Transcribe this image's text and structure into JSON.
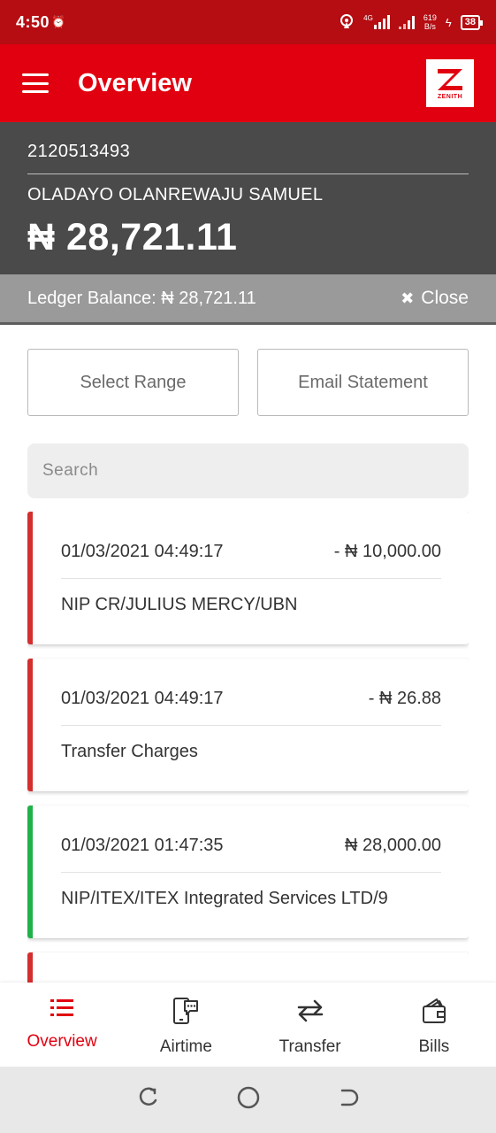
{
  "status_bar": {
    "time": "4:50",
    "network": "4G",
    "speed_value": "619",
    "speed_unit": "B/s",
    "battery": "38"
  },
  "app_bar": {
    "title": "Overview",
    "logo_text": "ZENITH",
    "logo_icon": "zenith-logo"
  },
  "account": {
    "number": "2120513493",
    "name": "OLADAYO OLANREWAJU SAMUEL",
    "balance": "₦ 28,721.11"
  },
  "ledger": {
    "label": "Ledger Balance: ₦ 28,721.11",
    "close_label": "Close"
  },
  "actions": {
    "select_range": "Select Range",
    "email_statement": "Email Statement"
  },
  "search": {
    "placeholder": "Search"
  },
  "transactions": [
    {
      "datetime": "01/03/2021 04:49:17",
      "amount": "- ₦ 10,000.00",
      "description": "NIP CR/JULIUS MERCY/UBN",
      "type": "debit"
    },
    {
      "datetime": "01/03/2021 04:49:17",
      "amount": "- ₦ 26.88",
      "description": "Transfer Charges",
      "type": "debit"
    },
    {
      "datetime": "01/03/2021 01:47:35",
      "amount": "₦ 28,000.00",
      "description": "NIP/ITEX/ITEX Integrated Services LTD/9",
      "type": "credit"
    }
  ],
  "bottom_nav": [
    {
      "label": "Overview",
      "icon": "list-icon",
      "active": true
    },
    {
      "label": "Airtime",
      "icon": "phone-chat-icon",
      "active": false
    },
    {
      "label": "Transfer",
      "icon": "transfer-arrows-icon",
      "active": false
    },
    {
      "label": "Bills",
      "icon": "wallet-icon",
      "active": false
    }
  ],
  "colors": {
    "brand_red": "#e1000f",
    "status_red": "#b50d12",
    "debit": "#d32f2f",
    "credit": "#21b14b",
    "panel_dark": "#4a4a4a",
    "ledger_grey": "#9a9a9a"
  }
}
